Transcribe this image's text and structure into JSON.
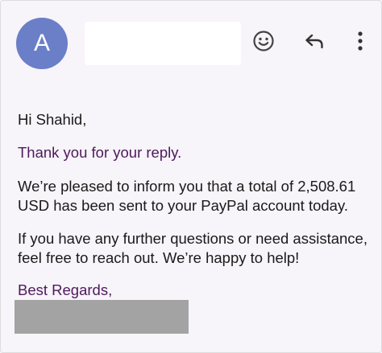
{
  "header": {
    "avatar_initial": "A",
    "icons": {
      "emoji": "emoji-smile-icon",
      "reply": "reply-arrow-icon",
      "more": "more-vertical-icon"
    }
  },
  "message": {
    "greeting": "Hi Shahid,",
    "thanks": "Thank you for your reply.",
    "paragraph1_line1": "We’re pleased to inform you that a total of 2,508.61",
    "paragraph1_line2": "USD has been sent to your PayPal account today.",
    "paragraph2_line1": "If you have any further questions or need assistance,",
    "paragraph2_line2": "feel free to reach out. We’re happy to help!",
    "signoff": "Best Regards,"
  },
  "colors": {
    "avatar": "#6a7fc8",
    "accent_text": "#4e1a5b",
    "background": "#f7f4fa",
    "redaction": "#a3a3a3"
  }
}
